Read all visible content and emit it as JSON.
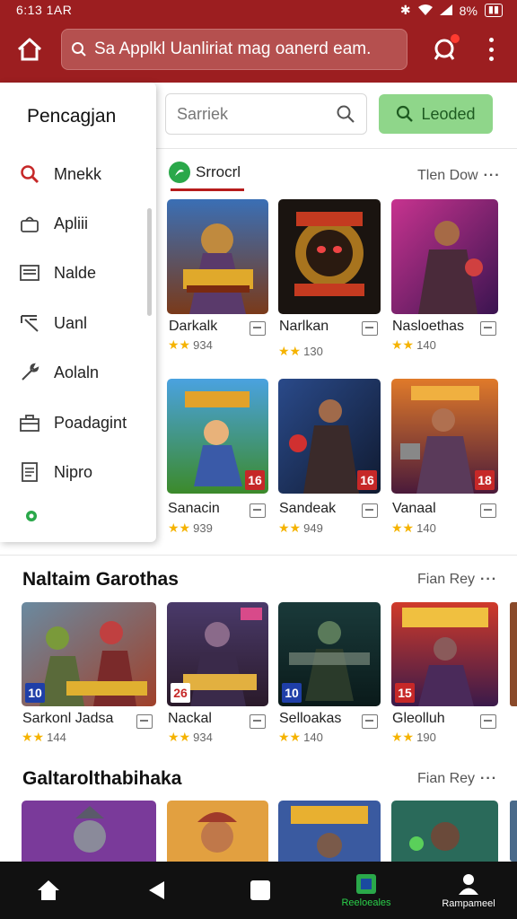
{
  "status": {
    "time": "6:13 1AR",
    "battery": "8%",
    "percent_label": "8%"
  },
  "header": {
    "search_text": "Sa Applkl Uanliriat mag oanerd eam."
  },
  "drawer": {
    "title": "Pencagjan",
    "items": [
      {
        "label": "Mnekk",
        "icon": "search-icon"
      },
      {
        "label": "Apliii",
        "icon": "bag-icon"
      },
      {
        "label": "Nalde",
        "icon": "card-icon"
      },
      {
        "label": "Uanl",
        "icon": "tools-icon"
      },
      {
        "label": "Aolaln",
        "icon": "wrench-icon"
      },
      {
        "label": "Poadagint",
        "icon": "toolbox-icon"
      },
      {
        "label": "Nipro",
        "icon": "document-icon"
      }
    ]
  },
  "toolbar": {
    "search_placeholder": "Sarriek",
    "loaded_label": "Leoded"
  },
  "section_top": {
    "tab_label": "Srrocrl",
    "see_all": "Tlen Dow",
    "games": [
      {
        "title": "Darkalk",
        "rating": "934",
        "badge": ""
      },
      {
        "title": "Narlkan",
        "rating": "130",
        "badge": ""
      },
      {
        "title": "Nasloethas",
        "rating": "140",
        "badge": ""
      },
      {
        "title": "Sanacin",
        "rating": "939",
        "badge": "16"
      },
      {
        "title": "Sandeak",
        "rating": "949",
        "badge": "16"
      },
      {
        "title": "Vanaal",
        "rating": "140",
        "badge": "18"
      }
    ]
  },
  "section_mid": {
    "title": "Naltaim Garothas",
    "see_all": "Fian Rey",
    "games": [
      {
        "title": "Sarkonl Jadsa",
        "rating": "144",
        "badge": "10"
      },
      {
        "title": "Nackal",
        "rating": "934",
        "badge": "26"
      },
      {
        "title": "Selloakas",
        "rating": "140",
        "badge": "10"
      },
      {
        "title": "Gleolluh",
        "rating": "190",
        "badge": "15"
      }
    ]
  },
  "section_bottom": {
    "title": "Galtarolthabihaka",
    "see_all": "Fian Rey"
  },
  "bottom_nav": {
    "games_label": "Reeloeales",
    "profile_label": "Rampameel"
  },
  "colors": {
    "brand": "#9c1e20",
    "accent_green": "#8fd68a",
    "star": "#f5b301",
    "badge_blue": "#1f3fa8",
    "badge_red": "#c62828"
  }
}
